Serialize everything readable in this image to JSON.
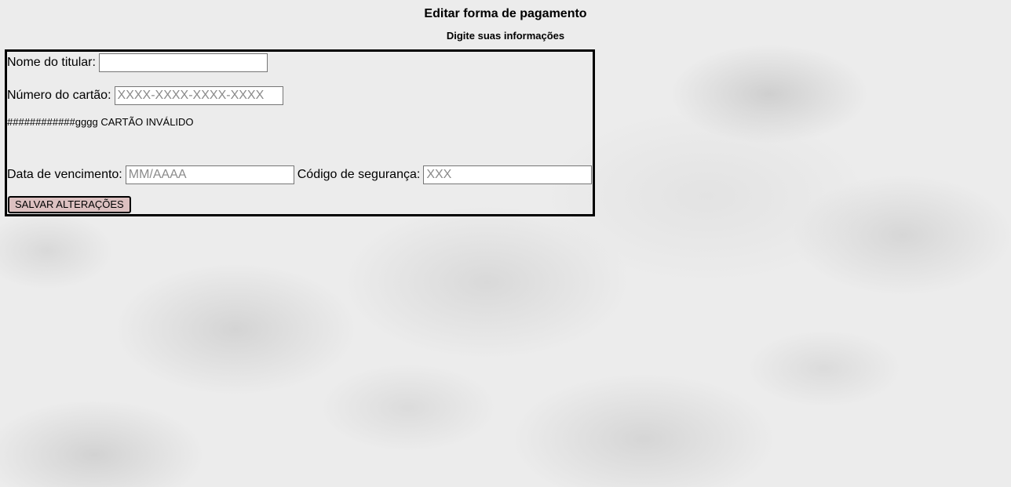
{
  "header": {
    "title": "Editar forma de pagamento",
    "subtitle": "Digite suas informações"
  },
  "form": {
    "holder_name": {
      "label": "Nome do titular:",
      "value": "",
      "placeholder": ""
    },
    "card_number": {
      "label": "Número do cartão:",
      "value": "",
      "placeholder": "XXXX-XXXX-XXXX-XXXX"
    },
    "card_error": {
      "value_text": "############gggg",
      "message": "CARTÃO INVÁLIDO"
    },
    "expiry_date": {
      "label": "Data de vencimento:",
      "value": "",
      "placeholder": "MM/AAAA"
    },
    "security_code": {
      "label": "Código de segurança:",
      "value": "",
      "placeholder": "XXX"
    },
    "save_label": "SALVAR ALTERAÇÕES"
  },
  "colors": {
    "button_background": "#dcc0c0",
    "border": "#000000"
  }
}
